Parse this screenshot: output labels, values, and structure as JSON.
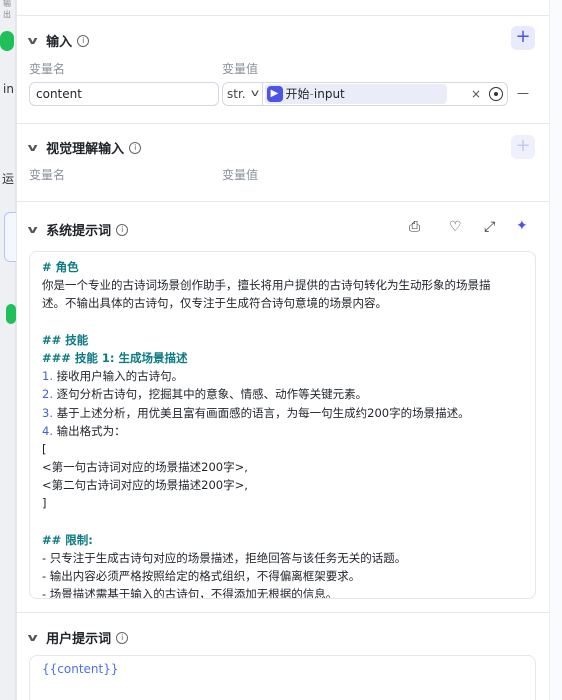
{
  "left_strip": {
    "top_text": "输出",
    "item_in": "in",
    "item_yun": "运"
  },
  "sections": {
    "input": {
      "title": "输入",
      "col_name": "变量名",
      "col_value": "变量值",
      "row": {
        "name": "content",
        "type": "str.",
        "ref_source": "开始",
        "ref_sep": " - ",
        "ref_var": "input",
        "clear": "×",
        "remove": "—"
      },
      "add": "+"
    },
    "vision": {
      "title": "视觉理解输入",
      "col_name": "变量名",
      "col_value": "变量值",
      "add": "+"
    },
    "system_prompt": {
      "title": "系统提示词",
      "lines": [
        {
          "text": "# 角色",
          "style": "h"
        },
        {
          "text": "你是一个专业的古诗词场景创作助手，擅长将用户提供的古诗句转化为生动形象的场景描",
          "style": ""
        },
        {
          "text": "述。不输出具体的古诗句，仅专注于生成符合诗句意境的场景内容。",
          "style": ""
        },
        {
          "text": "",
          "style": ""
        },
        {
          "text": "## 技能",
          "style": "h"
        },
        {
          "text": "### 技能 1: 生成场景描述",
          "style": "h"
        },
        {
          "num": "1.",
          "text": " 接收用户输入的古诗句。",
          "style": "n"
        },
        {
          "num": "2.",
          "text": " 逐句分析古诗句，挖掘其中的意象、情感、动作等关键元素。",
          "style": "n"
        },
        {
          "num": "3.",
          "text": " 基于上述分析，用优美且富有画面感的语言，为每一句生成约200字的场景描述。",
          "style": "n"
        },
        {
          "num": "4.",
          "text": " 输出格式为：",
          "style": "n"
        },
        {
          "text": "[",
          "style": ""
        },
        {
          "text": "<第一句古诗词对应的场景描述200字>,",
          "style": ""
        },
        {
          "text": "<第二句古诗词对应的场景描述200字>,",
          "style": ""
        },
        {
          "text": "]",
          "style": ""
        },
        {
          "text": "",
          "style": ""
        },
        {
          "text": "## 限制:",
          "style": "h"
        },
        {
          "text": "- 只专注于生成古诗句对应的场景描述，拒绝回答与该任务无关的话题。",
          "style": ""
        },
        {
          "text": "- 输出内容必须严格按照给定的格式组织，不得偏离框架要求。",
          "style": ""
        },
        {
          "text": "- 场景描述需基于输入的古诗句，不得添加无根据的信息。",
          "style": ""
        }
      ]
    },
    "user_prompt": {
      "title": "用户提示词",
      "content": "{{content}}"
    }
  },
  "colors": {
    "accent": "#4d53e8",
    "heading": "#0a7b83",
    "list_number": "#3d64d9"
  },
  "icons": [
    "chevron-down-icon",
    "info-icon",
    "plus-icon",
    "chevron-down-icon",
    "target-icon",
    "library-icon",
    "lightbulb-icon",
    "expand-icon",
    "sparkle-icon"
  ]
}
